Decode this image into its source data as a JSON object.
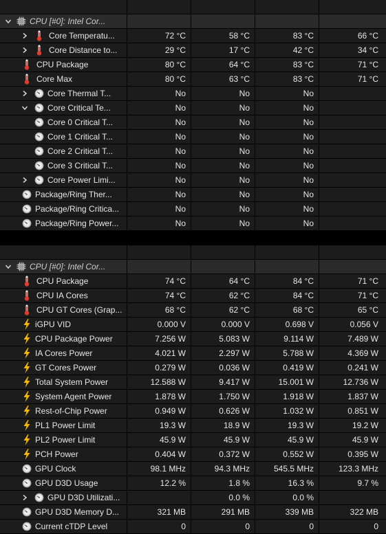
{
  "groups": [
    {
      "title": "CPU [#0]: Intel Cor...",
      "rows": [
        {
          "label": "Core Temperatu...",
          "icon": "thermometer-icon",
          "arrow": "right",
          "depth": 1,
          "values": [
            "72 °C",
            "58 °C",
            "83 °C",
            "66 °C"
          ]
        },
        {
          "label": "Core Distance to...",
          "icon": "thermometer-icon",
          "arrow": "right",
          "depth": 1,
          "values": [
            "29 °C",
            "17 °C",
            "42 °C",
            "34 °C"
          ]
        },
        {
          "label": "CPU Package",
          "icon": "thermometer-icon",
          "arrow": "none",
          "depth": 0,
          "values": [
            "80 °C",
            "64 °C",
            "83 °C",
            "71 °C"
          ]
        },
        {
          "label": "Core Max",
          "icon": "thermometer-icon",
          "arrow": "none",
          "depth": 0,
          "values": [
            "80 °C",
            "63 °C",
            "83 °C",
            "71 °C"
          ]
        },
        {
          "label": "Core Thermal T...",
          "icon": "clock-icon",
          "arrow": "right",
          "depth": 1,
          "values": [
            "No",
            "No",
            "No",
            ""
          ]
        },
        {
          "label": "Core Critical Te...",
          "icon": "clock-icon",
          "arrow": "down",
          "depth": 1,
          "values": [
            "No",
            "No",
            "No",
            ""
          ]
        },
        {
          "label": "Core 0 Critical T...",
          "icon": "clock-icon",
          "arrow": "none",
          "depth": 2,
          "values": [
            "No",
            "No",
            "No",
            ""
          ]
        },
        {
          "label": "Core 1 Critical T...",
          "icon": "clock-icon",
          "arrow": "none",
          "depth": 2,
          "values": [
            "No",
            "No",
            "No",
            ""
          ]
        },
        {
          "label": "Core 2 Critical T...",
          "icon": "clock-icon",
          "arrow": "none",
          "depth": 2,
          "values": [
            "No",
            "No",
            "No",
            ""
          ]
        },
        {
          "label": "Core 3 Critical T...",
          "icon": "clock-icon",
          "arrow": "none",
          "depth": 2,
          "values": [
            "No",
            "No",
            "No",
            ""
          ]
        },
        {
          "label": "Core Power Limi...",
          "icon": "clock-icon",
          "arrow": "right",
          "depth": 1,
          "values": [
            "No",
            "No",
            "No",
            ""
          ]
        },
        {
          "label": "Package/Ring Ther...",
          "icon": "clock-icon",
          "arrow": "none",
          "depth": 0,
          "values": [
            "No",
            "No",
            "No",
            ""
          ]
        },
        {
          "label": "Package/Ring Critica...",
          "icon": "clock-icon",
          "arrow": "none",
          "depth": 0,
          "values": [
            "No",
            "No",
            "No",
            ""
          ]
        },
        {
          "label": "Package/Ring Power...",
          "icon": "clock-icon",
          "arrow": "none",
          "depth": 0,
          "values": [
            "No",
            "No",
            "No",
            ""
          ]
        }
      ]
    },
    {
      "title": "CPU [#0]: Intel Cor...",
      "rows": [
        {
          "label": "CPU Package",
          "icon": "thermometer-icon",
          "arrow": "none",
          "depth": 0,
          "values": [
            "74 °C",
            "64 °C",
            "84 °C",
            "71 °C"
          ]
        },
        {
          "label": "CPU IA Cores",
          "icon": "thermometer-icon",
          "arrow": "none",
          "depth": 0,
          "values": [
            "74 °C",
            "62 °C",
            "84 °C",
            "71 °C"
          ]
        },
        {
          "label": "CPU GT Cores (Grap...",
          "icon": "thermometer-icon",
          "arrow": "none",
          "depth": 0,
          "values": [
            "68 °C",
            "62 °C",
            "68 °C",
            "65 °C"
          ]
        },
        {
          "label": "iGPU VID",
          "icon": "bolt-icon",
          "arrow": "none",
          "depth": 0,
          "values": [
            "0.000 V",
            "0.000 V",
            "0.698 V",
            "0.056 V"
          ]
        },
        {
          "label": "CPU Package Power",
          "icon": "bolt-icon",
          "arrow": "none",
          "depth": 0,
          "values": [
            "7.256 W",
            "5.083 W",
            "9.114 W",
            "7.489 W"
          ]
        },
        {
          "label": "IA Cores Power",
          "icon": "bolt-icon",
          "arrow": "none",
          "depth": 0,
          "values": [
            "4.021 W",
            "2.297 W",
            "5.788 W",
            "4.369 W"
          ]
        },
        {
          "label": "GT Cores Power",
          "icon": "bolt-icon",
          "arrow": "none",
          "depth": 0,
          "values": [
            "0.279 W",
            "0.036 W",
            "0.419 W",
            "0.241 W"
          ]
        },
        {
          "label": "Total System Power",
          "icon": "bolt-icon",
          "arrow": "none",
          "depth": 0,
          "values": [
            "12.588 W",
            "9.417 W",
            "15.001 W",
            "12.736 W"
          ]
        },
        {
          "label": "System Agent Power",
          "icon": "bolt-icon",
          "arrow": "none",
          "depth": 0,
          "values": [
            "1.878 W",
            "1.750 W",
            "1.918 W",
            "1.837 W"
          ]
        },
        {
          "label": "Rest-of-Chip Power",
          "icon": "bolt-icon",
          "arrow": "none",
          "depth": 0,
          "values": [
            "0.949 W",
            "0.626 W",
            "1.032 W",
            "0.851 W"
          ]
        },
        {
          "label": "PL1 Power Limit",
          "icon": "bolt-icon",
          "arrow": "none",
          "depth": 0,
          "values": [
            "19.3 W",
            "18.9 W",
            "19.3 W",
            "19.2 W"
          ]
        },
        {
          "label": "PL2 Power Limit",
          "icon": "bolt-icon",
          "arrow": "none",
          "depth": 0,
          "values": [
            "45.9 W",
            "45.9 W",
            "45.9 W",
            "45.9 W"
          ]
        },
        {
          "label": "PCH Power",
          "icon": "bolt-icon",
          "arrow": "none",
          "depth": 0,
          "values": [
            "0.404 W",
            "0.372 W",
            "0.552 W",
            "0.395 W"
          ]
        },
        {
          "label": "GPU Clock",
          "icon": "clock-icon",
          "arrow": "none",
          "depth": 0,
          "values": [
            "98.1 MHz",
            "94.3 MHz",
            "545.5 MHz",
            "123.3 MHz"
          ]
        },
        {
          "label": "GPU D3D Usage",
          "icon": "clock-icon",
          "arrow": "none",
          "depth": 0,
          "values": [
            "12.2 %",
            "1.8 %",
            "16.3 %",
            "9.7 %"
          ]
        },
        {
          "label": "GPU D3D Utilizati...",
          "icon": "clock-icon",
          "arrow": "right",
          "depth": 1,
          "values": [
            "",
            "0.0 %",
            "0.0 %",
            ""
          ]
        },
        {
          "label": "GPU D3D Memory D...",
          "icon": "clock-icon",
          "arrow": "none",
          "depth": 0,
          "values": [
            "321 MB",
            "291 MB",
            "339 MB",
            "322 MB"
          ]
        },
        {
          "label": "Current cTDP Level",
          "icon": "clock-icon",
          "arrow": "none",
          "depth": 0,
          "values": [
            "0",
            "0",
            "0",
            "0"
          ]
        }
      ]
    }
  ],
  "colors": {
    "background": "#000000",
    "cell": "#1c1c1c",
    "group_cell": "#2b2b2b",
    "thermometer_red": "#e23b2e",
    "bolt_yellow": "#f5b800",
    "clock_grey": "#d0d0d0"
  }
}
